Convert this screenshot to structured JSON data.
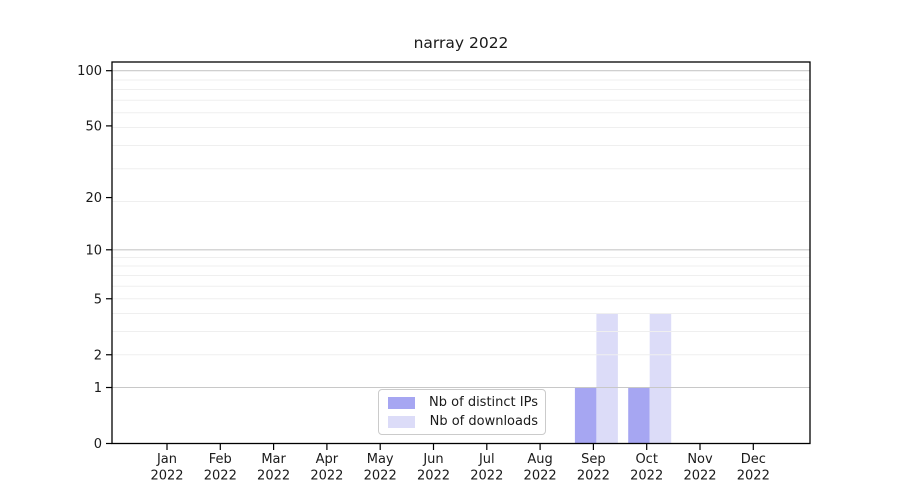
{
  "figure": {
    "background": "#ffffff",
    "text_color": "#1a1a1a",
    "axis_color": "#000000",
    "grid_major_color": "#c8c8c8",
    "grid_minor_color": "#efefef"
  },
  "chart_data": {
    "type": "bar",
    "title": "narray 2022",
    "categories": [
      "Jan",
      "Feb",
      "Mar",
      "Apr",
      "May",
      "Jun",
      "Jul",
      "Aug",
      "Sep",
      "Oct",
      "Nov",
      "Dec"
    ],
    "year": "2022",
    "series": [
      {
        "name": "Nb of distinct IPs",
        "color": "#a6a6f2",
        "values": [
          0,
          0,
          0,
          0,
          0,
          0,
          0,
          0,
          1,
          1,
          0,
          0
        ]
      },
      {
        "name": "Nb of downloads",
        "color": "#dcdcf8",
        "values": [
          0,
          0,
          0,
          0,
          0,
          0,
          0,
          0,
          4,
          4,
          0,
          0
        ]
      }
    ],
    "xlabel": "",
    "ylabel": "",
    "yticks": [
      0,
      1,
      2,
      5,
      10,
      20,
      50,
      100
    ],
    "ylim": [
      0,
      110
    ],
    "yscale": "log1p",
    "grid": true,
    "legend_position": "inside lower center"
  }
}
